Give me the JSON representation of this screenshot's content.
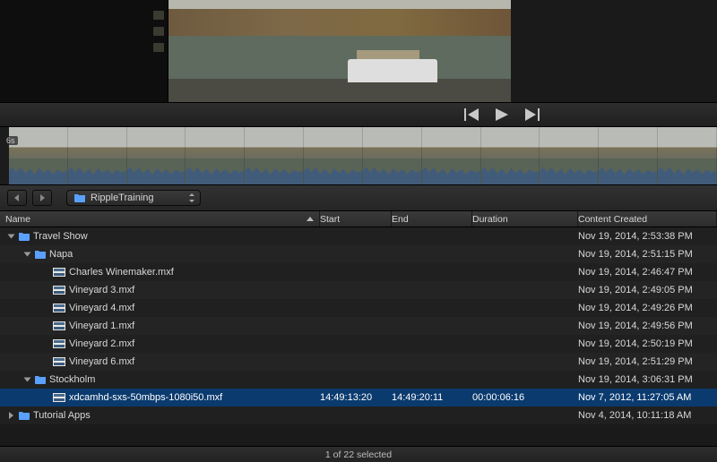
{
  "preview": {
    "timestamp_label": "6s"
  },
  "controls": {
    "prev_icon": "skip-back-icon",
    "play_icon": "play-icon",
    "next_icon": "skip-forward-icon"
  },
  "toolbar": {
    "back_icon": "chevron-left-icon",
    "forward_icon": "chevron-right-icon",
    "path_label": "RippleTraining"
  },
  "columns": {
    "name": "Name",
    "start": "Start",
    "end": "End",
    "duration": "Duration",
    "created": "Content Created"
  },
  "rows": [
    {
      "type": "folder",
      "depth": 0,
      "open": true,
      "label": "Travel Show",
      "start": "",
      "end": "",
      "duration": "",
      "created": "Nov 19, 2014, 2:53:38 PM",
      "selected": false
    },
    {
      "type": "folder",
      "depth": 1,
      "open": true,
      "label": "Napa",
      "start": "",
      "end": "",
      "duration": "",
      "created": "Nov 19, 2014, 2:51:15 PM",
      "selected": false
    },
    {
      "type": "clip",
      "depth": 2,
      "label": "Charles Winemaker.mxf",
      "start": "",
      "end": "",
      "duration": "",
      "created": "Nov 19, 2014, 2:46:47 PM",
      "selected": false
    },
    {
      "type": "clip",
      "depth": 2,
      "label": "Vineyard 3.mxf",
      "start": "",
      "end": "",
      "duration": "",
      "created": "Nov 19, 2014, 2:49:05 PM",
      "selected": false
    },
    {
      "type": "clip",
      "depth": 2,
      "label": "Vineyard 4.mxf",
      "start": "",
      "end": "",
      "duration": "",
      "created": "Nov 19, 2014, 2:49:26 PM",
      "selected": false
    },
    {
      "type": "clip",
      "depth": 2,
      "label": "Vineyard 1.mxf",
      "start": "",
      "end": "",
      "duration": "",
      "created": "Nov 19, 2014, 2:49:56 PM",
      "selected": false
    },
    {
      "type": "clip",
      "depth": 2,
      "label": "Vineyard 2.mxf",
      "start": "",
      "end": "",
      "duration": "",
      "created": "Nov 19, 2014, 2:50:19 PM",
      "selected": false
    },
    {
      "type": "clip",
      "depth": 2,
      "label": "Vineyard 6.mxf",
      "start": "",
      "end": "",
      "duration": "",
      "created": "Nov 19, 2014, 2:51:29 PM",
      "selected": false
    },
    {
      "type": "folder",
      "depth": 1,
      "open": true,
      "label": "Stockholm",
      "start": "",
      "end": "",
      "duration": "",
      "created": "Nov 19, 2014, 3:06:31 PM",
      "selected": false
    },
    {
      "type": "clip",
      "depth": 2,
      "label": "xdcamhd-sxs-50mbps-1080i50.mxf",
      "start": "14:49:13:20",
      "end": "14:49:20:11",
      "duration": "00:00:06:16",
      "created": "Nov 7, 2012, 11:27:05 AM",
      "selected": true
    },
    {
      "type": "folder",
      "depth": 0,
      "open": false,
      "label": "Tutorial Apps",
      "start": "",
      "end": "",
      "duration": "",
      "created": "Nov 4, 2014, 10:11:18 AM",
      "selected": false
    }
  ],
  "footer": {
    "status": "1 of 22 selected"
  },
  "filmstrip": {
    "frame_count": 12
  }
}
